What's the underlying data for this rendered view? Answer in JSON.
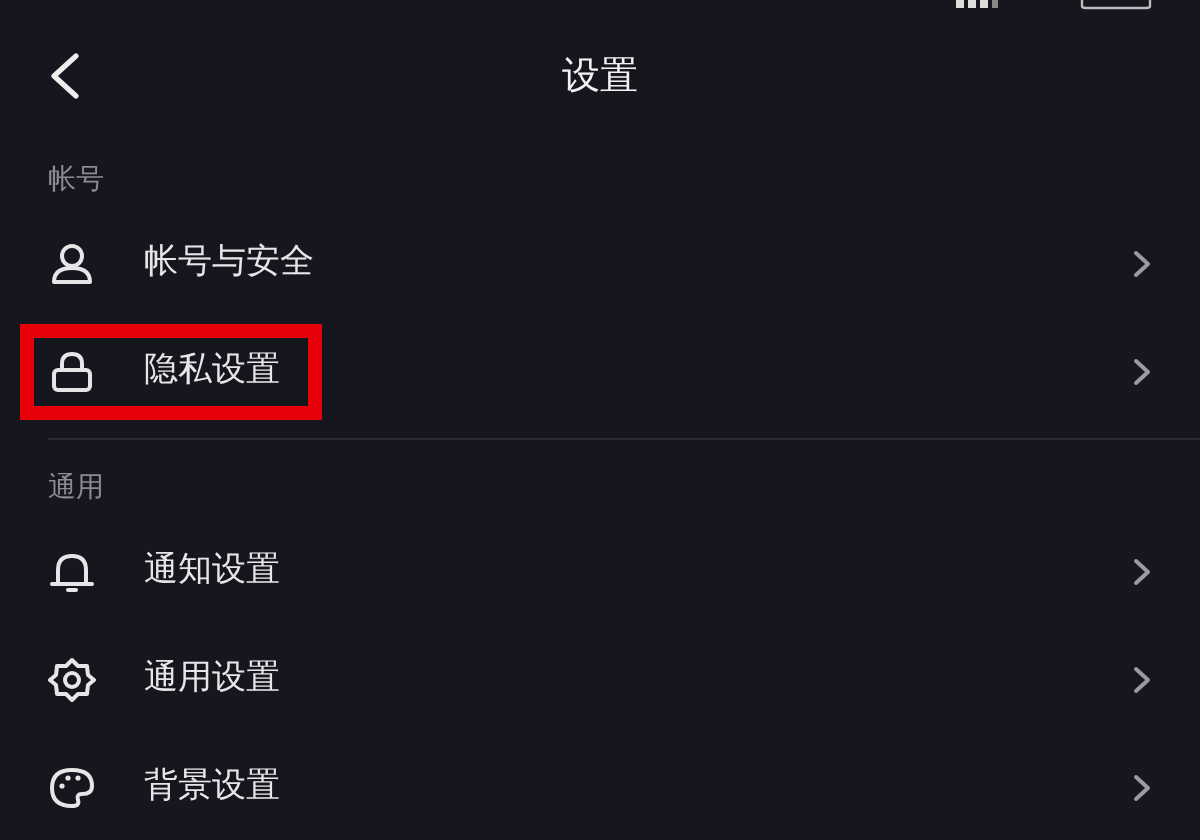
{
  "header": {
    "title": "设置"
  },
  "sections": [
    {
      "title": "帐号",
      "items": [
        {
          "label": "帐号与安全",
          "kind": "person",
          "highlighted": false
        },
        {
          "label": "隐私设置",
          "kind": "lock",
          "highlighted": true
        }
      ]
    },
    {
      "title": "通用",
      "items": [
        {
          "label": "通知设置",
          "kind": "bell",
          "highlighted": false
        },
        {
          "label": "通用设置",
          "kind": "gear",
          "highlighted": false
        },
        {
          "label": "背景设置",
          "kind": "palette",
          "highlighted": false
        }
      ]
    }
  ]
}
